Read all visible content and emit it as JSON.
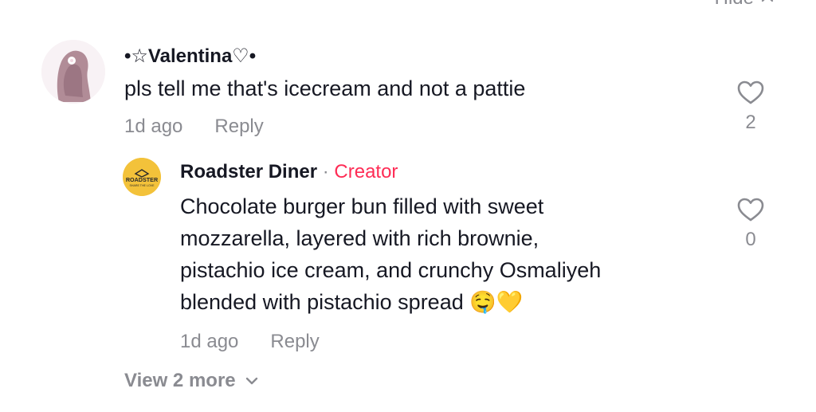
{
  "header": {
    "hide_label": "Hide"
  },
  "comments": [
    {
      "username": "•☆Valentina♡•",
      "text": "pls tell me that's icecream and not a pattie",
      "time": "1d ago",
      "reply_label": "Reply",
      "likes": "2"
    }
  ],
  "replies": [
    {
      "username": "Roadster Diner",
      "separator": "·",
      "badge": "Creator",
      "avatar_text": "ROADSTER",
      "avatar_subtext": "SHARE THE LOVE",
      "text_lines": [
        "Chocolate burger bun filled with sweet",
        "mozzarella, layered with rich brownie,",
        "pistachio ice cream, and crunchy Osmaliyeh",
        "blended with pistachio spread"
      ],
      "emoji": "🤤💛",
      "time": "1d ago",
      "reply_label": "Reply",
      "likes": "0"
    }
  ],
  "view_more_label": "View 2 more",
  "colors": {
    "primary_text": "#161823",
    "secondary_text": "#8a8b91",
    "creator_badge": "#fe2c55",
    "roadster_avatar_bg": "#f3c23a"
  }
}
